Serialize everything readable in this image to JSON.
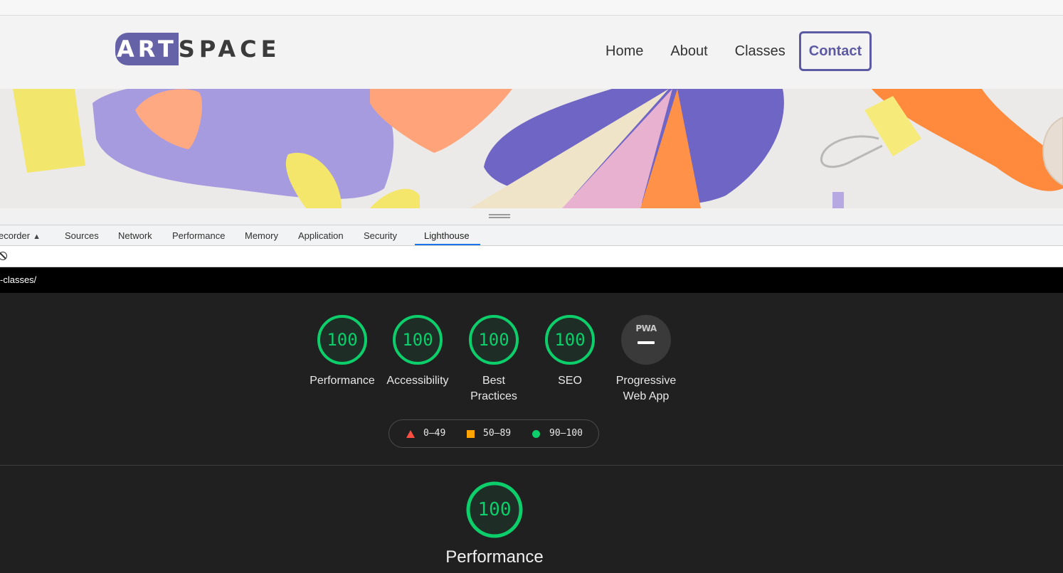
{
  "site": {
    "logo_art": "ART",
    "logo_space": "SPACE",
    "nav": [
      "Home",
      "About",
      "Classes"
    ],
    "contact_label": "Contact"
  },
  "devtools": {
    "tabs": [
      "ecorder",
      "Sources",
      "Network",
      "Performance",
      "Memory",
      "Application",
      "Security",
      "Lighthouse"
    ],
    "active_tab": "Lighthouse",
    "url": "-classes/"
  },
  "lighthouse": {
    "scores": [
      {
        "score": "100",
        "label": "Performance"
      },
      {
        "score": "100",
        "label": "Accessibility"
      },
      {
        "score": "100",
        "label": "Best Practices"
      },
      {
        "score": "100",
        "label": "SEO"
      }
    ],
    "pwa": {
      "badge_text": "PWA",
      "label": "Progressive Web App"
    },
    "legend": {
      "fail": "0–49",
      "average": "50–89",
      "pass": "90–100"
    },
    "main_score": "100",
    "main_title": "Performance",
    "colors": {
      "pass": "#0cce6b",
      "average": "#ffa400",
      "fail": "#ff4e42",
      "background": "#202020"
    }
  }
}
